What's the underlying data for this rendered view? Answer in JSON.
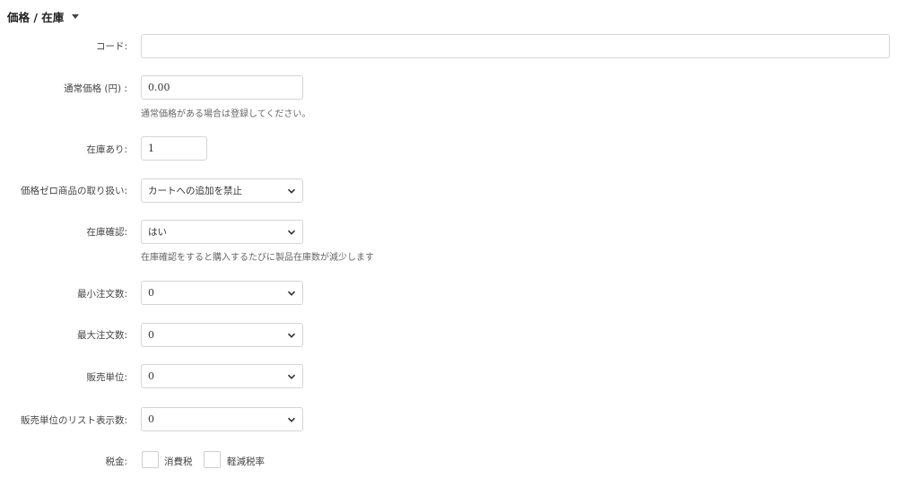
{
  "section": {
    "title": "価格 / 在庫"
  },
  "fields": {
    "code": {
      "label": "コード:",
      "value": ""
    },
    "regular_price": {
      "label": "通常価格 (円) :",
      "value": "0.00",
      "help": "通常価格がある場合は登録してください。"
    },
    "stock": {
      "label": "在庫あり:",
      "value": "1"
    },
    "zero_price": {
      "label": "価格ゼロ商品の取り扱い:",
      "value": "カートへの追加を禁止"
    },
    "stock_check": {
      "label": "在庫確認:",
      "value": "はい",
      "help": "在庫確認をすると購入するたびに製品在庫数が減少します"
    },
    "min_qty": {
      "label": "最小注文数:",
      "value": "0"
    },
    "max_qty": {
      "label": "最大注文数:",
      "value": "0"
    },
    "sales_unit": {
      "label": "販売単位:",
      "value": "0"
    },
    "sales_unit_list": {
      "label": "販売単位のリスト表示数:",
      "value": "0"
    },
    "tax": {
      "label": "税金:",
      "options": [
        {
          "label": "消費税",
          "checked": false
        },
        {
          "label": "軽減税率",
          "checked": false
        }
      ]
    }
  },
  "icons": {
    "section_toggle": "caret-down-icon",
    "select_arrow": "chevron-down-icon"
  }
}
